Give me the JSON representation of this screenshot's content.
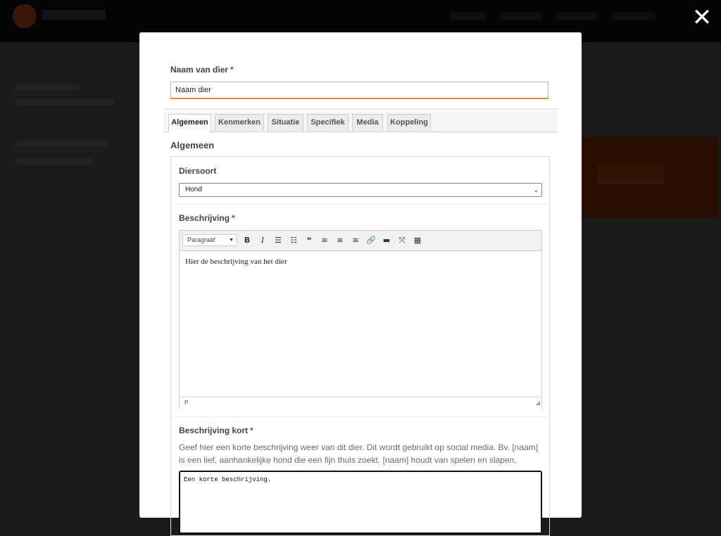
{
  "modal": {
    "close_icon": "close-icon",
    "name_field": {
      "label": "Naam van dier",
      "required": "*",
      "value": "Naam dier"
    },
    "tabs": [
      {
        "label": "Algemeen",
        "active": true
      },
      {
        "label": "Kenmerken",
        "active": false
      },
      {
        "label": "Situatie",
        "active": false
      },
      {
        "label": "Specifiek",
        "active": false
      },
      {
        "label": "Media",
        "active": false
      },
      {
        "label": "Koppeling",
        "active": false
      }
    ],
    "section_title": "Algemeen",
    "species": {
      "label": "Diersoort",
      "selected": "Hond"
    },
    "description": {
      "label": "Beschrijving",
      "required": "*",
      "format_select": "Paragraaf",
      "content": "Hier de beschrijving van het dier",
      "status_path": "P",
      "toolbar_icons": [
        "bold-icon",
        "italic-icon",
        "bullet-list-icon",
        "numbered-list-icon",
        "blockquote-icon",
        "align-left-icon",
        "align-center-icon",
        "align-right-icon",
        "link-icon",
        "read-more-icon",
        "fullscreen-icon",
        "toolbar-toggle-icon"
      ]
    },
    "short_description": {
      "label": "Beschrijving kort",
      "required": "*",
      "help": "Geef hier een korte beschrijving weer van dit dier. Dit wordt gebruikt op social media. Bv. [naam] is een lief, aanhankelijke hond die een fijn thuis zoekt. [naam] houdt van spelen en slapen.",
      "value": "Een korte beschrijving."
    }
  }
}
